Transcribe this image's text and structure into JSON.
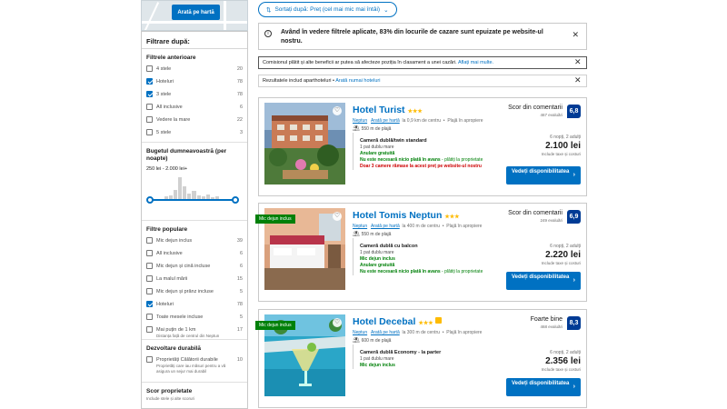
{
  "map": {
    "button_label": "Arată pe hartă"
  },
  "filters": {
    "title": "Filtrare după:",
    "previous": {
      "heading": "Filtrele anterioare",
      "items": [
        {
          "label": "4 stele",
          "count": "20",
          "checked": false
        },
        {
          "label": "Hoteluri",
          "count": "78",
          "checked": true
        },
        {
          "label": "3 stele",
          "count": "78",
          "checked": true
        },
        {
          "label": "All inclusive",
          "count": "6",
          "checked": false
        },
        {
          "label": "Vedere la mare",
          "count": "22",
          "checked": false
        },
        {
          "label": "5 stele",
          "count": "3",
          "checked": false
        }
      ]
    },
    "budget": {
      "heading": "Bugetul dumneavoastră (per noapte)",
      "value": "250 lei - 2.000 lei+",
      "range": [
        250,
        2000
      ]
    },
    "popular": {
      "heading": "Filtre populare",
      "items": [
        {
          "label": "Mic dejun inclus",
          "count": "39",
          "checked": false
        },
        {
          "label": "All inclusive",
          "count": "6",
          "checked": false
        },
        {
          "label": "Mic dejun și cină incluse",
          "count": "6",
          "checked": false
        },
        {
          "label": "La malul mării",
          "count": "15",
          "checked": false
        },
        {
          "label": "Mic dejun și prânz incluse",
          "count": "5",
          "checked": false
        },
        {
          "label": "Hoteluri",
          "count": "78",
          "checked": true
        },
        {
          "label": "Toate mesele incluse",
          "count": "5",
          "checked": false
        },
        {
          "label": "Mai puțin de 1 km",
          "sub": "Distanța față de centrul din Neptun",
          "count": "17",
          "checked": false
        }
      ]
    },
    "sustainable": {
      "heading": "Dezvoltare durabilă",
      "items": [
        {
          "label": "Proprietăți Călătorii durabile",
          "sub": "Proprietăți care iau măsuri pentru a vă asigura un sejur mai durabil",
          "count": "10",
          "checked": false
        }
      ]
    },
    "score": {
      "heading": "Scor proprietate",
      "sub": "Include stele și alte scoruri"
    }
  },
  "sort": {
    "label": "Sortați după: Preț (cel mai mic mai întâi)",
    "icon": "sort-arrows-icon"
  },
  "banner": {
    "text": "Având în vedere filtrele aplicate, 83% din locurile de cazare sunt epuizate pe website-ul nostru."
  },
  "commission": {
    "text": "Comisionul plătit și alte beneficii ar putea să afecteze poziția în clasament a unei cazări.",
    "link": "Aflați mai multe."
  },
  "aparthotel": {
    "text": "Rezultatele includ aparthoteluri •",
    "link": "Arată numai hoteluri"
  },
  "hotels": [
    {
      "name": "Hotel Turist",
      "stars": "★★★",
      "thumb": false,
      "ribbon": "",
      "loc_city": "Neptun",
      "loc_map": "Arată pe hartă",
      "loc_dist": "la 0,9 km de centru",
      "loc_beach": "Plajă în apropiere",
      "beach": "550 m de plajă",
      "score_text": "Scor din comentarii",
      "score_count": "467 evaluări",
      "score": "6,8",
      "room": "Cameră dublă/twin standard",
      "bed": "1 pat dublu mare",
      "perks": [
        {
          "t": "Anulare gratuită",
          "s": ""
        },
        {
          "t": "Nu este necesară nicio plată în avans",
          "s": " - plătiți la proprietate"
        }
      ],
      "warn": "Doar 3 camere rămase la acest preț pe website-ul nostru",
      "nights": "6 nopți, 2 adulți",
      "price": "2.100 lei",
      "taxes": "Include taxe și costuri",
      "cta": "Vedeți disponibilitatea"
    },
    {
      "name": "Hotel Tomis Neptun",
      "stars": "★★★",
      "thumb": false,
      "ribbon": "Mic dejun inclus",
      "loc_city": "Neptun",
      "loc_map": "Arată pe hartă",
      "loc_dist": "la 400 m de centru",
      "loc_beach": "Plajă în apropiere",
      "beach": "550 m de plajă",
      "score_text": "Scor din comentarii",
      "score_count": "249 evaluări",
      "score": "6,9",
      "room": "Cameră dublă cu balcon",
      "bed": "1 pat dublu mare",
      "perks": [
        {
          "t": "Mic dejun inclus",
          "s": ""
        },
        {
          "t": "Anulare gratuită",
          "s": ""
        },
        {
          "t": "Nu este necesară nicio plată în avans",
          "s": " - plătiți la proprietate"
        }
      ],
      "warn": "",
      "nights": "6 nopți, 2 adulți",
      "price": "2.220 lei",
      "taxes": "Include taxe și costuri",
      "cta": "Vedeți disponibilitatea"
    },
    {
      "name": "Hotel Decebal",
      "stars": "★★★",
      "thumb": true,
      "ribbon": "Mic dejun inclus",
      "loc_city": "Neptun",
      "loc_map": "Arată pe hartă",
      "loc_dist": "la 300 m de centru",
      "loc_beach": "Plajă în apropiere",
      "beach": "600 m de plajă",
      "score_text": "Foarte bine",
      "score_count": "468 evaluări",
      "score": "8,3",
      "room": "Cameră dublă Economy - la parter",
      "bed": "1 pat dublu mare",
      "perks": [
        {
          "t": "Mic dejun inclus",
          "s": ""
        }
      ],
      "warn": "",
      "nights": "6 nopți, 2 adulți",
      "price": "2.356 lei",
      "taxes": "Include taxe și costuri",
      "cta": "Vedeți disponibilitatea"
    }
  ],
  "colors": {
    "accent": "#0071c2",
    "badge": "#003b95",
    "green": "#008009",
    "star": "#febb02",
    "warn": "#cc0000"
  }
}
